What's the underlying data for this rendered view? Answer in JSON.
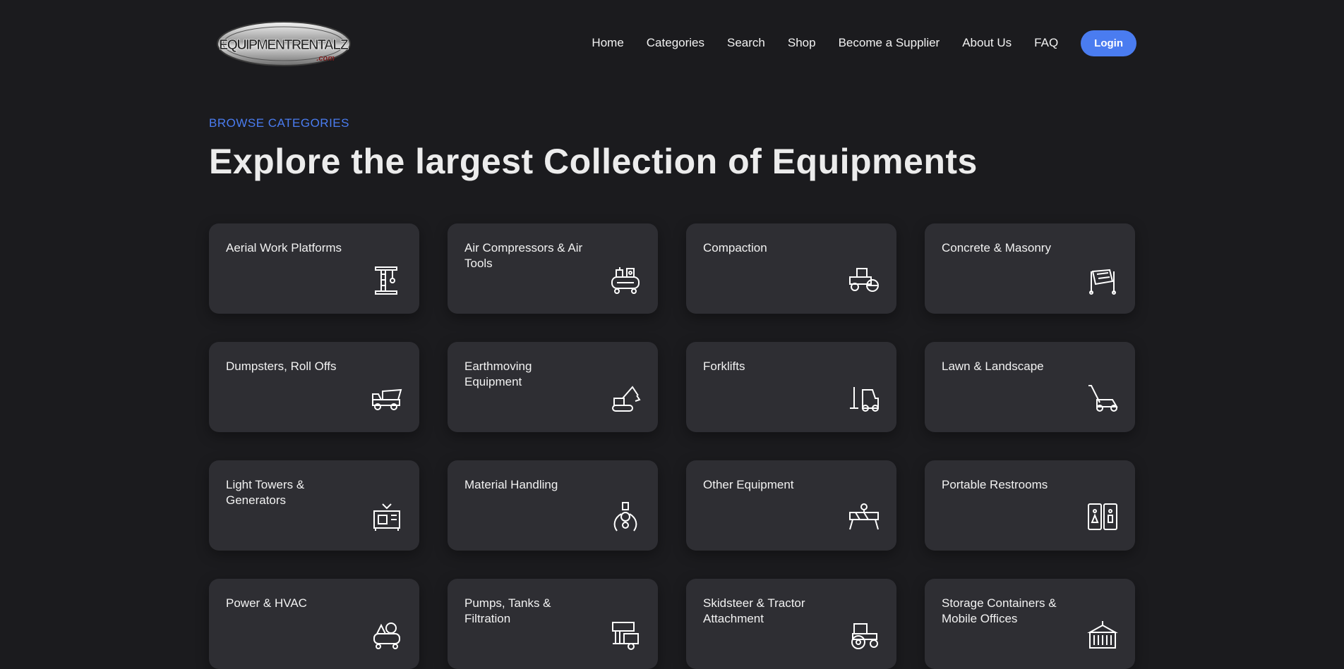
{
  "header": {
    "logo_text": "EQUIPMENTRENTALZ",
    "logo_sub": ".com",
    "nav": [
      "Home",
      "Categories",
      "Search",
      "Shop",
      "Become a Supplier",
      "About Us",
      "FAQ"
    ],
    "login_label": "Login"
  },
  "hero": {
    "eyebrow": "BROWSE CATEGORIES",
    "title": "Explore the largest Collection of Equipments"
  },
  "categories": [
    {
      "label": "Aerial Work Platforms",
      "icon": "lift-icon"
    },
    {
      "label": "Air Compressors & Air Tools",
      "icon": "compressor-icon"
    },
    {
      "label": "Compaction",
      "icon": "roller-icon"
    },
    {
      "label": "Concrete & Masonry",
      "icon": "mixer-icon"
    },
    {
      "label": "Dumpsters, Roll Offs",
      "icon": "dump-truck-icon"
    },
    {
      "label": "Earthmoving Equipment",
      "icon": "excavator-icon"
    },
    {
      "label": "Forklifts",
      "icon": "forklift-icon"
    },
    {
      "label": "Lawn & Landscape",
      "icon": "lawn-mower-icon"
    },
    {
      "label": "Light Towers & Generators",
      "icon": "generator-icon"
    },
    {
      "label": "Material Handling",
      "icon": "claw-icon"
    },
    {
      "label": "Other Equipment",
      "icon": "barrier-icon"
    },
    {
      "label": "Portable Restrooms",
      "icon": "restroom-icon"
    },
    {
      "label": "Power & HVAC",
      "icon": "hvac-icon"
    },
    {
      "label": "Pumps, Tanks & Filtration",
      "icon": "pump-icon"
    },
    {
      "label": "Skidsteer & Tractor Attachment",
      "icon": "tractor-icon"
    },
    {
      "label": "Storage Containers & Mobile Offices",
      "icon": "container-icon"
    }
  ],
  "colors": {
    "background": "#1b1b1e",
    "card": "#2e2e33",
    "accent": "#4a7cf0"
  }
}
